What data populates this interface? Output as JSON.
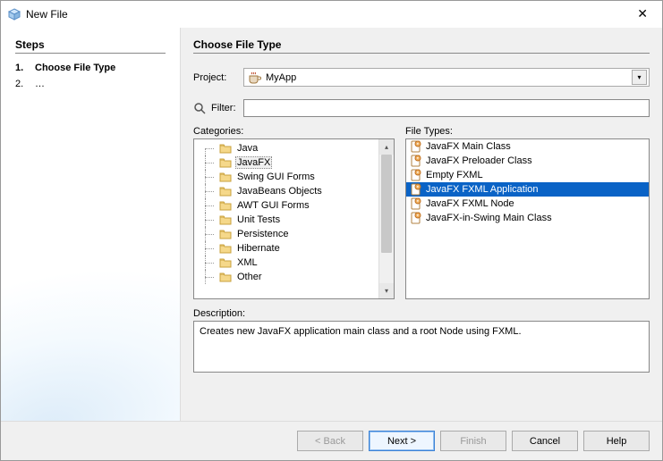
{
  "window": {
    "title": "New File"
  },
  "sidebar": {
    "heading": "Steps",
    "steps": [
      {
        "num": "1.",
        "label": "Choose File Type",
        "active": true
      },
      {
        "num": "2.",
        "label": "…",
        "active": false
      }
    ]
  },
  "main": {
    "heading": "Choose File Type",
    "project_label": "Project:",
    "project_value": "MyApp",
    "filter_label": "Filter:",
    "filter_value": "",
    "categories_label": "Categories:",
    "categories": [
      "Java",
      "JavaFX",
      "Swing GUI Forms",
      "JavaBeans Objects",
      "AWT GUI Forms",
      "Unit Tests",
      "Persistence",
      "Hibernate",
      "XML",
      "Other"
    ],
    "category_selected_index": 1,
    "filetypes_label": "File Types:",
    "filetypes": [
      "JavaFX Main Class",
      "JavaFX Preloader Class",
      "Empty FXML",
      "JavaFX FXML Application",
      "JavaFX FXML Node",
      "JavaFX-in-Swing Main Class"
    ],
    "filetype_selected_index": 3,
    "description_label": "Description:",
    "description_text": "Creates new JavaFX application main class and a root Node using FXML."
  },
  "footer": {
    "back": "< Back",
    "next": "Next >",
    "finish": "Finish",
    "cancel": "Cancel",
    "help": "Help"
  }
}
